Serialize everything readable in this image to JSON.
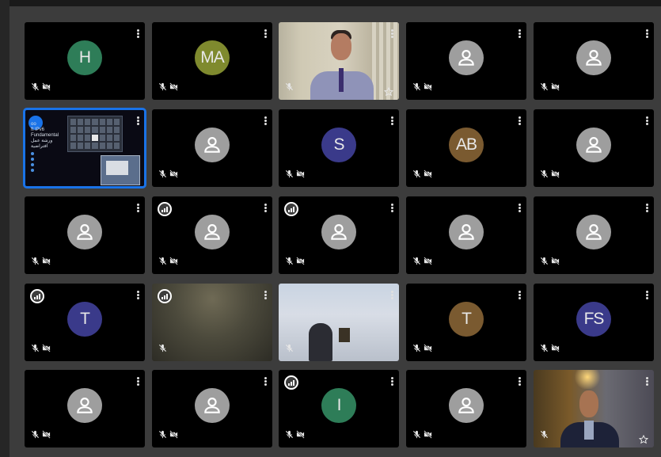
{
  "meeting": {
    "participants": [
      {
        "initials": "H",
        "color": "#2e7d58",
        "signal": false,
        "star": false
      },
      {
        "initials": "MA",
        "color": "#7f8a2e",
        "signal": false,
        "star": false
      },
      {
        "initials": "",
        "video": "lecturer",
        "signal": false,
        "star": true
      },
      {
        "initials": "",
        "generic": true,
        "signal": false,
        "star": false
      },
      {
        "initials": "",
        "generic": true,
        "signal": false,
        "star": false
      },
      {
        "initials": "",
        "video": "screen-share",
        "signal": false,
        "star": false
      },
      {
        "initials": "",
        "generic": true,
        "signal": false,
        "star": false
      },
      {
        "initials": "S",
        "color": "#3a3a8a",
        "signal": false,
        "star": false
      },
      {
        "initials": "AB",
        "color": "#7a5a30",
        "signal": false,
        "star": false
      },
      {
        "initials": "",
        "generic": true,
        "signal": false,
        "star": false
      },
      {
        "initials": "",
        "generic": true,
        "signal": false,
        "star": false
      },
      {
        "initials": "",
        "generic": true,
        "signal": true,
        "star": false
      },
      {
        "initials": "",
        "generic": true,
        "signal": true,
        "star": false
      },
      {
        "initials": "",
        "generic": true,
        "signal": false,
        "star": false
      },
      {
        "initials": "",
        "generic": true,
        "signal": false,
        "star": false
      },
      {
        "initials": "T",
        "color": "#3a3a8a",
        "signal": true,
        "star": false
      },
      {
        "initials": "",
        "video": "blurry",
        "signal": true,
        "star": false
      },
      {
        "initials": "",
        "video": "dim",
        "signal": false,
        "star": false
      },
      {
        "initials": "T",
        "color": "#7a5a30",
        "signal": false,
        "star": false
      },
      {
        "initials": "FS",
        "color": "#3a3a8a",
        "signal": false,
        "star": false
      },
      {
        "initials": "",
        "generic": true,
        "signal": false,
        "star": false
      },
      {
        "initials": "",
        "generic": true,
        "signal": false,
        "star": false
      },
      {
        "initials": "I",
        "color": "#2e7d58",
        "signal": true,
        "star": false
      },
      {
        "initials": "",
        "generic": true,
        "signal": false,
        "star": false
      },
      {
        "initials": "",
        "video": "room",
        "signal": false,
        "star": true
      }
    ]
  },
  "screen_share": {
    "title_line1": "oo",
    "title_line2": "ft IPv6",
    "title_line3": "Fundamental",
    "title_line4": "ورشة عمل افتراضية"
  },
  "colors": {
    "background": "#3c3c3c",
    "tile": "#000000",
    "active_border": "#1a73e8"
  }
}
